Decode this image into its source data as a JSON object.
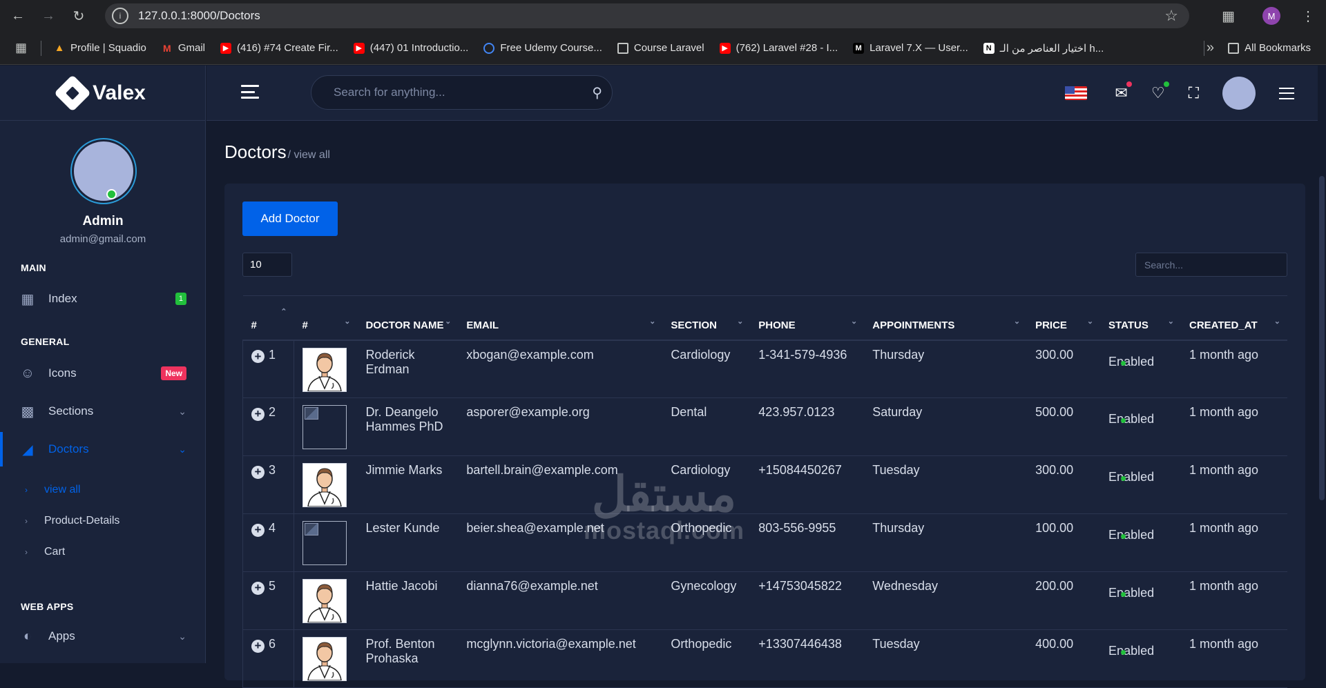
{
  "browser": {
    "url": "127.0.0.1:8000/Doctors",
    "profile_initial": "M",
    "bookmarks": [
      {
        "label": "Profile | Squadio",
        "icon": "squadio-icon",
        "color": "#f5a623"
      },
      {
        "label": "Gmail",
        "icon": "gmail-icon",
        "color": "#ea4335"
      },
      {
        "label": "(416) #74 Create Fir...",
        "icon": "youtube-icon",
        "color": "#ff0000"
      },
      {
        "label": "(447) 01 Introductio...",
        "icon": "youtube-icon",
        "color": "#ff0000"
      },
      {
        "label": "Free Udemy Course...",
        "icon": "search-globe-icon",
        "color": "#4285f4"
      },
      {
        "label": "Course Laravel",
        "icon": "folder-icon",
        "color": "transparent"
      },
      {
        "label": "(762) Laravel #28 - I...",
        "icon": "youtube-icon",
        "color": "#ff0000"
      },
      {
        "label": "Laravel 7.X — User...",
        "icon": "medium-icon",
        "color": "#000000"
      },
      {
        "label": "اختيار العناصر من الـ h...",
        "icon": "notion-icon",
        "color": "#ffffff"
      }
    ],
    "all_bookmarks": "All Bookmarks"
  },
  "app": {
    "brand": "Valex",
    "search_placeholder": "Search for anything...",
    "user": {
      "name": "Admin",
      "email": "admin@gmail.com"
    }
  },
  "sidebar": {
    "main_label": "MAIN",
    "general_label": "GENERAL",
    "webapps_label": "WEB APPS",
    "items": {
      "index": {
        "label": "Index",
        "badge": "1"
      },
      "icons": {
        "label": "Icons",
        "badge": "New"
      },
      "sections": {
        "label": "Sections"
      },
      "doctors": {
        "label": "Doctors"
      },
      "apps": {
        "label": "Apps"
      }
    },
    "sub_items": [
      "view all",
      "Product-Details",
      "Cart"
    ]
  },
  "page": {
    "title": "Doctors",
    "subtitle": "/ view all",
    "add_button": "Add Doctor",
    "page_length": "10",
    "table_search_placeholder": "Search..."
  },
  "table": {
    "headers": [
      "#",
      "#",
      "DOCTOR NAME",
      "EMAIL",
      "SECTION",
      "PHONE",
      "APPOINTMENTS",
      "PRICE",
      "STATUS",
      "CREATED_AT"
    ],
    "rows": [
      {
        "no": "1",
        "image": "doctor-avatar",
        "name": "Roderick Erdman",
        "email": "xbogan@example.com",
        "section": "Cardiology",
        "phone": "1-341-579-4936",
        "appointments": "Thursday",
        "price": "300.00",
        "status": "Enabled",
        "created": "1 month ago"
      },
      {
        "no": "2",
        "image": "broken",
        "name": "Dr. Deangelo Hammes PhD",
        "email": "asporer@example.org",
        "section": "Dental",
        "phone": "423.957.0123",
        "appointments": "Saturday",
        "price": "500.00",
        "status": "Enabled",
        "created": "1 month ago"
      },
      {
        "no": "3",
        "image": "doctor-avatar",
        "name": "Jimmie Marks",
        "email": "bartell.brain@example.com",
        "section": "Cardiology",
        "phone": "+15084450267",
        "appointments": "Tuesday",
        "price": "300.00",
        "status": "Enabled",
        "created": "1 month ago"
      },
      {
        "no": "4",
        "image": "broken",
        "name": "Lester Kunde",
        "email": "beier.shea@example.net",
        "section": "Orthopedic",
        "phone": "803-556-9955",
        "appointments": "Thursday",
        "price": "100.00",
        "status": "Enabled",
        "created": "1 month ago"
      },
      {
        "no": "5",
        "image": "doctor-avatar",
        "name": "Hattie Jacobi",
        "email": "dianna76@example.net",
        "section": "Gynecology",
        "phone": "+14753045822",
        "appointments": "Wednesday",
        "price": "200.00",
        "status": "Enabled",
        "created": "1 month ago"
      },
      {
        "no": "6",
        "image": "doctor-avatar",
        "name": "Prof. Benton Prohaska",
        "email": "mcglynn.victoria@example.net",
        "section": "Orthopedic",
        "phone": "+13307446438",
        "appointments": "Tuesday",
        "price": "400.00",
        "status": "Enabled",
        "created": "1 month ago"
      }
    ]
  },
  "watermark": {
    "arabic": "مستقل",
    "latin": "mostaql.com"
  },
  "colors": {
    "accent": "#0162e8",
    "success": "#22c03c",
    "danger": "#ee335e",
    "bg": "#141b2d",
    "panel": "#1a233a"
  }
}
